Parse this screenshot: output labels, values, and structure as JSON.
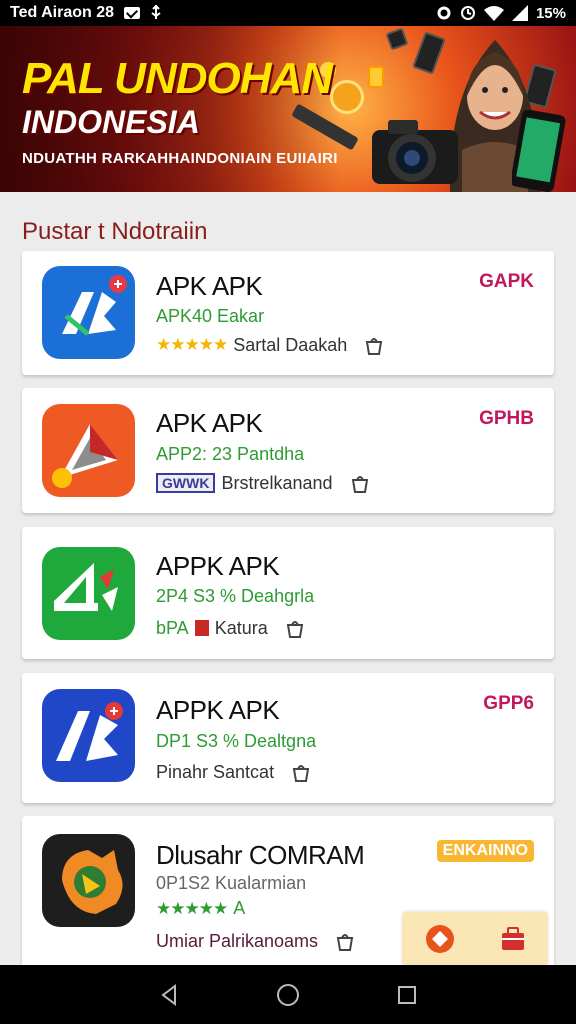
{
  "status_bar": {
    "carrier_time": "Ted Airaon 28",
    "battery": "15%"
  },
  "banner": {
    "title": "PAL UNDOHAN",
    "subtitle": "INDONESIA",
    "tagline": "NDUATHH RARKAHHAINDONIAIN EUIIAIRI"
  },
  "section": {
    "title": "Pustar t Ndotraiin"
  },
  "apps": [
    {
      "name": "APK APK",
      "sub": "APK40 Eakar",
      "meta": "Sartal Daakah",
      "badge": "GAPK",
      "stars": "★★★★★",
      "icon": "rb-blue-app-icon",
      "icon_color": "#1c6fd6"
    },
    {
      "name": "APK APK",
      "sub": "APP2: 23 Pantdha",
      "meta": "Brstrelkanand",
      "meta_prefix": "GWWK",
      "badge": "GPHB",
      "icon": "orange-arrow-app-icon",
      "icon_color": "#ef5a24"
    },
    {
      "name": "APPK APK",
      "sub": "2P4 S3 % Deahgrla",
      "meta": "Katura",
      "meta_prefix": "bPA",
      "icon": "green-4-app-icon",
      "icon_color": "#1fa83c"
    },
    {
      "name": "APPK APK",
      "sub": "DP1 S3 % Dealtgna",
      "meta": "Pinahr Santcat",
      "badge": "GPP6",
      "icon": "blue-ab-app-icon",
      "icon_color": "#2147c9"
    },
    {
      "name": "Dlusahr COMRAM",
      "sub": "0P1S2 Kualarmian",
      "meta": "Umiar Palrikanoams",
      "badge": "ENKAINNO",
      "stars": "★★★★★",
      "stars_suffix": "A",
      "icon": "dark-orange-app-icon",
      "icon_color": "#1e1e1e"
    }
  ],
  "colors": {
    "accent": "#c2185b",
    "section_title": "#8a1c1c",
    "green_text": "#2e9b33",
    "star": "#f4b400"
  }
}
